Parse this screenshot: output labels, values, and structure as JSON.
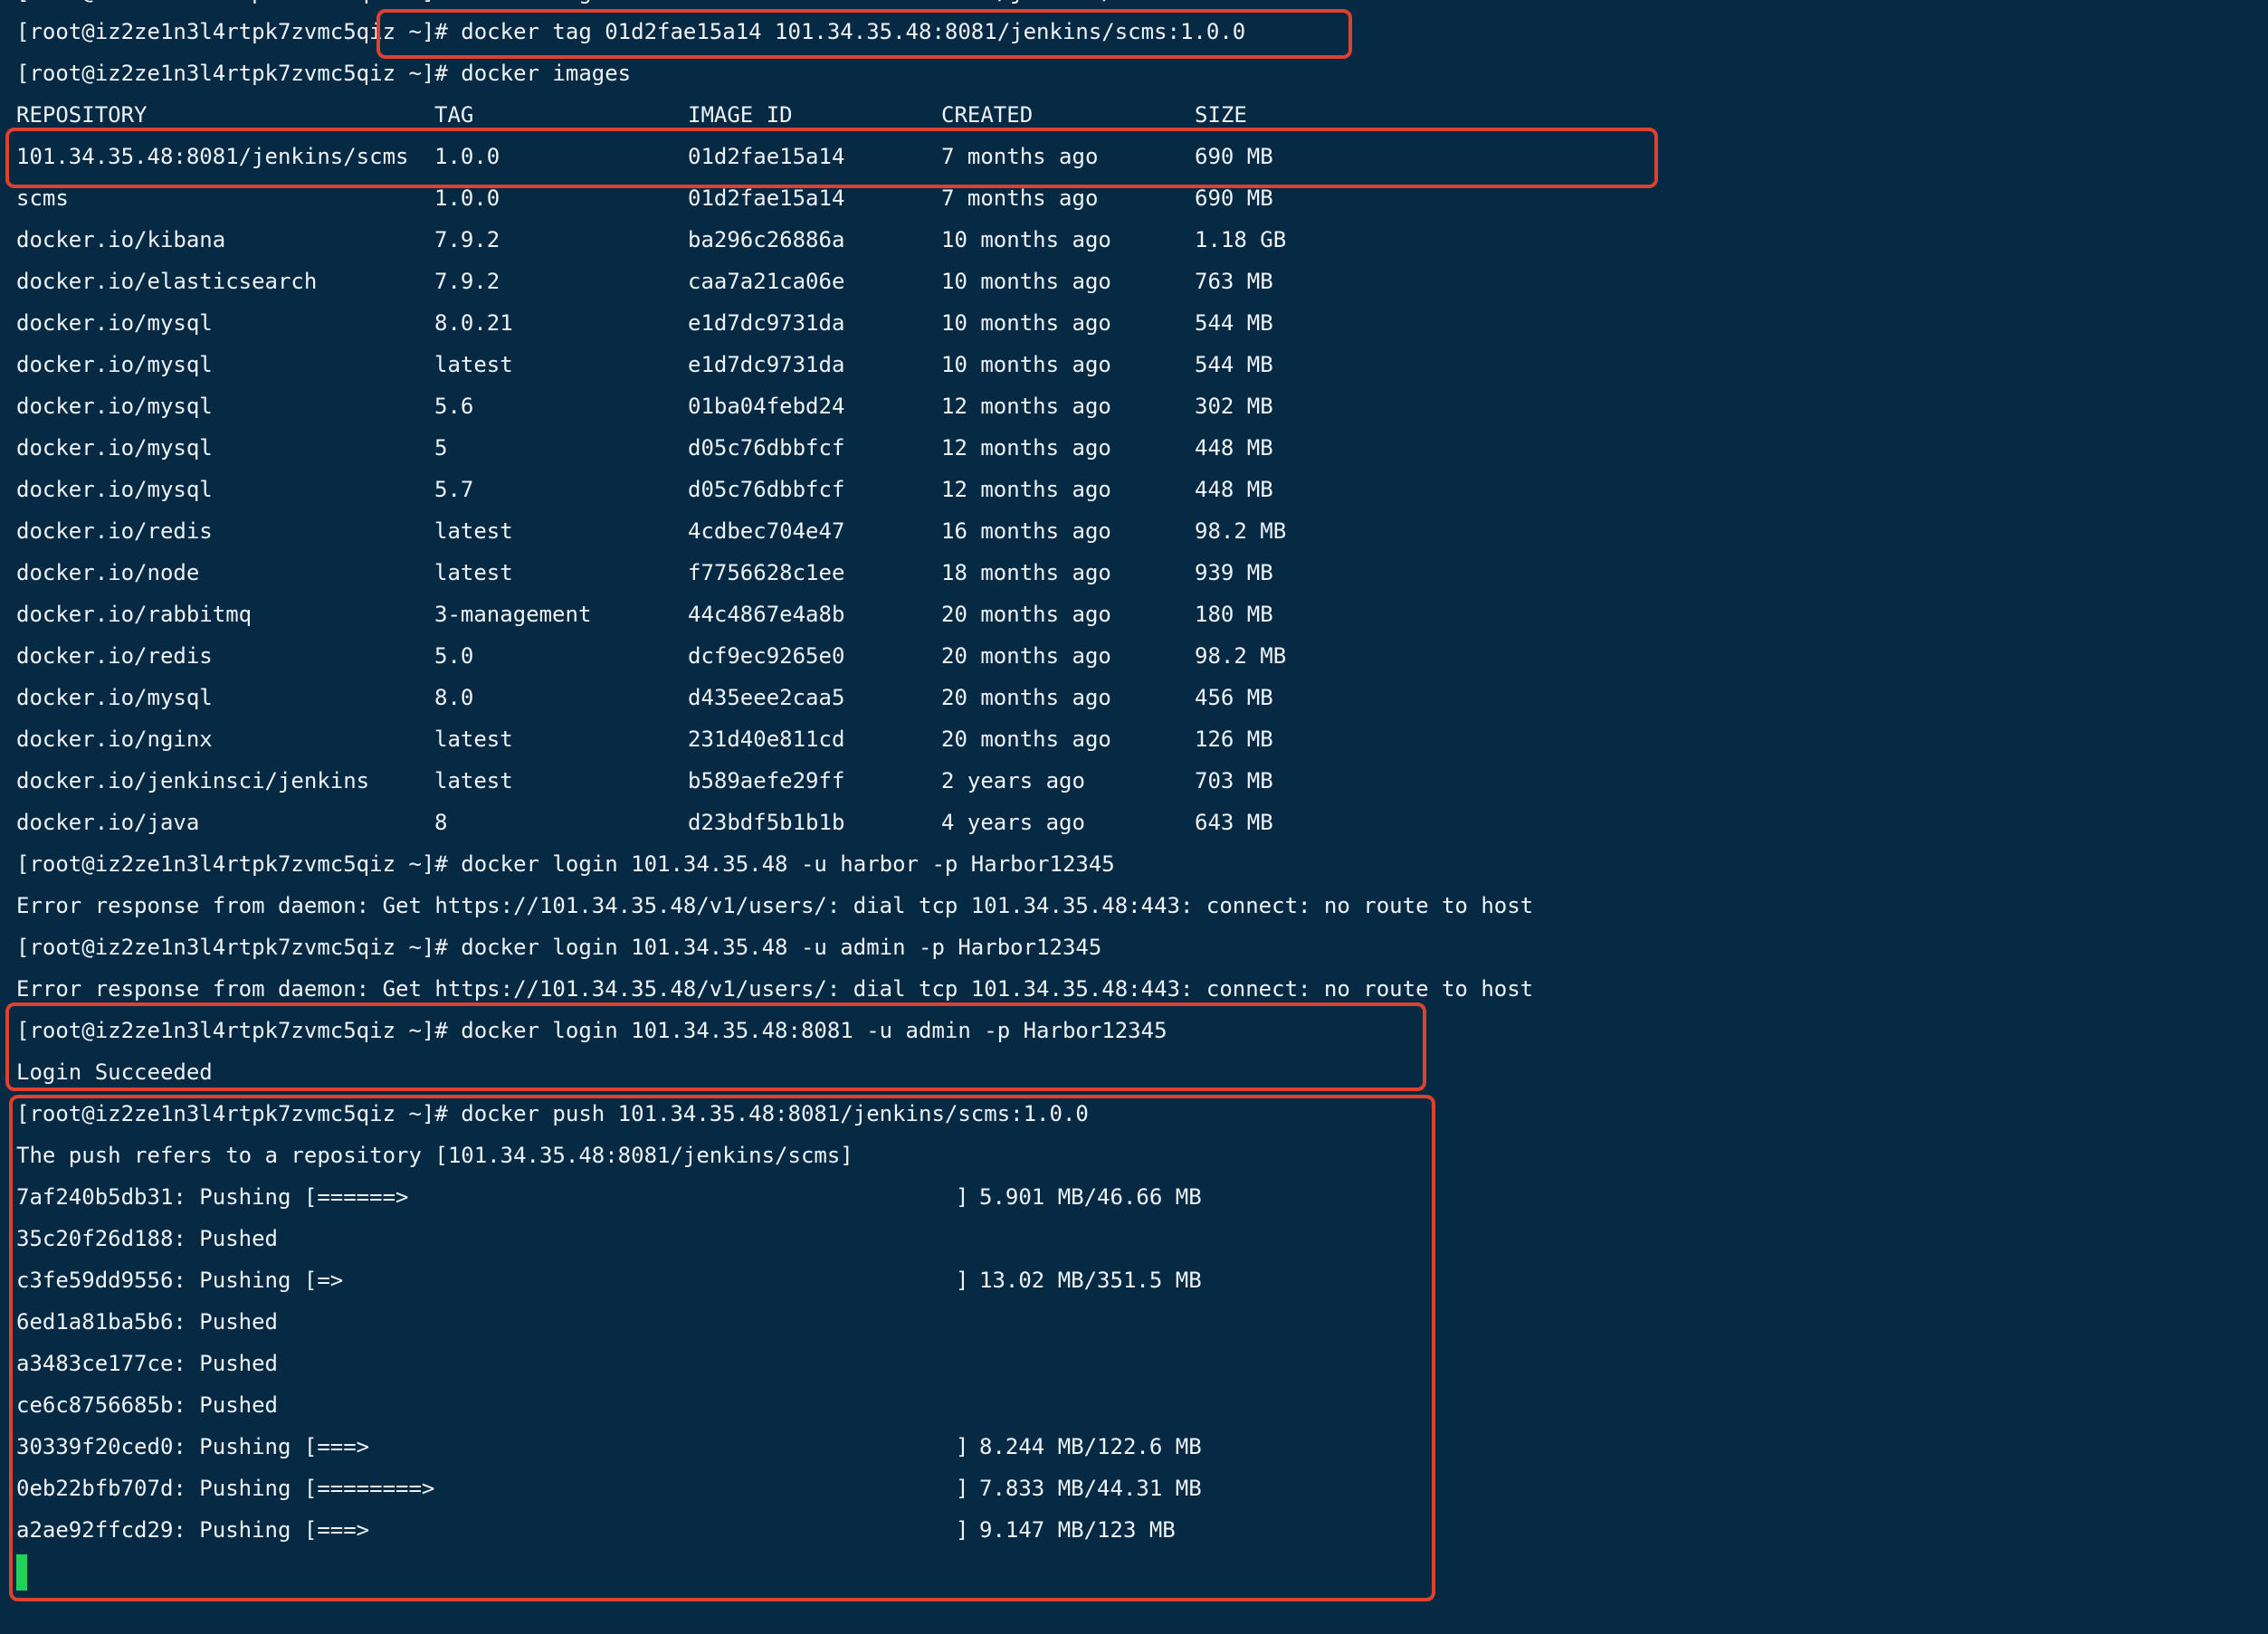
{
  "terminal": {
    "partial_line": "[root@iz2ze1n3l4rtpk7zvmc5qiz ~]# docker tag 01d2fae15a14 101.34.35.48:8081/jenkins/scms:1.0.0",
    "cmd_tag": "[root@iz2ze1n3l4rtpk7zvmc5qiz ~]# docker tag 01d2fae15a14 101.34.35.48:8081/jenkins/scms:1.0.0",
    "cmd_images": "[root@iz2ze1n3l4rtpk7zvmc5qiz ~]# docker images",
    "table": {
      "headers": [
        "REPOSITORY",
        "TAG",
        "IMAGE ID",
        "CREATED",
        "SIZE"
      ],
      "rows": [
        [
          "101.34.35.48:8081/jenkins/scms",
          "1.0.0",
          "01d2fae15a14",
          "7 months ago",
          "690 MB"
        ],
        [
          "scms",
          "1.0.0",
          "01d2fae15a14",
          "7 months ago",
          "690 MB"
        ],
        [
          "docker.io/kibana",
          "7.9.2",
          "ba296c26886a",
          "10 months ago",
          "1.18 GB"
        ],
        [
          "docker.io/elasticsearch",
          "7.9.2",
          "caa7a21ca06e",
          "10 months ago",
          "763 MB"
        ],
        [
          "docker.io/mysql",
          "8.0.21",
          "e1d7dc9731da",
          "10 months ago",
          "544 MB"
        ],
        [
          "docker.io/mysql",
          "latest",
          "e1d7dc9731da",
          "10 months ago",
          "544 MB"
        ],
        [
          "docker.io/mysql",
          "5.6",
          "01ba04febd24",
          "12 months ago",
          "302 MB"
        ],
        [
          "docker.io/mysql",
          "5",
          "d05c76dbbfcf",
          "12 months ago",
          "448 MB"
        ],
        [
          "docker.io/mysql",
          "5.7",
          "d05c76dbbfcf",
          "12 months ago",
          "448 MB"
        ],
        [
          "docker.io/redis",
          "latest",
          "4cdbec704e47",
          "16 months ago",
          "98.2 MB"
        ],
        [
          "docker.io/node",
          "latest",
          "f7756628c1ee",
          "18 months ago",
          "939 MB"
        ],
        [
          "docker.io/rabbitmq",
          "3-management",
          "44c4867e4a8b",
          "20 months ago",
          "180 MB"
        ],
        [
          "docker.io/redis",
          "5.0",
          "dcf9ec9265e0",
          "20 months ago",
          "98.2 MB"
        ],
        [
          "docker.io/mysql",
          "8.0",
          "d435eee2caa5",
          "20 months ago",
          "456 MB"
        ],
        [
          "docker.io/nginx",
          "latest",
          "231d40e811cd",
          "20 months ago",
          "126 MB"
        ],
        [
          "docker.io/jenkinsci/jenkins",
          "latest",
          "b589aefe29ff",
          "2 years ago",
          "703 MB"
        ],
        [
          "docker.io/java",
          "8",
          "d23bdf5b1b1b",
          "4 years ago",
          "643 MB"
        ]
      ]
    },
    "cmd_login_harbor": "[root@iz2ze1n3l4rtpk7zvmc5qiz ~]# docker login 101.34.35.48 -u harbor -p Harbor12345",
    "err_1": "Error response from daemon: Get https://101.34.35.48/v1/users/: dial tcp 101.34.35.48:443: connect: no route to host",
    "cmd_login_admin": "[root@iz2ze1n3l4rtpk7zvmc5qiz ~]# docker login 101.34.35.48 -u admin -p Harbor12345",
    "err_2": "Error response from daemon: Get https://101.34.35.48/v1/users/: dial tcp 101.34.35.48:443: connect: no route to host",
    "cmd_login_8081": "[root@iz2ze1n3l4rtpk7zvmc5qiz ~]# docker login 101.34.35.48:8081 -u admin -p Harbor12345",
    "login_succeeded": "Login Succeeded",
    "cmd_push": "[root@iz2ze1n3l4rtpk7zvmc5qiz ~]# docker push 101.34.35.48:8081/jenkins/scms:1.0.0",
    "push_refers": "The push refers to a repository [101.34.35.48:8081/jenkins/scms]",
    "push_layers": [
      {
        "layer": "7af240b5db31: Pushing [======>",
        "bracket": "]",
        "progress": "5.901 MB/46.66 MB"
      },
      {
        "layer": "35c20f26d188: Pushed",
        "bracket": "",
        "progress": ""
      },
      {
        "layer": "c3fe59dd9556: Pushing [=>",
        "bracket": "]",
        "progress": "13.02 MB/351.5 MB"
      },
      {
        "layer": "6ed1a81ba5b6: Pushed",
        "bracket": "",
        "progress": ""
      },
      {
        "layer": "a3483ce177ce: Pushed",
        "bracket": "",
        "progress": ""
      },
      {
        "layer": "ce6c8756685b: Pushed",
        "bracket": "",
        "progress": ""
      },
      {
        "layer": "30339f20ced0: Pushing [===>",
        "bracket": "]",
        "progress": "8.244 MB/122.6 MB"
      },
      {
        "layer": "0eb22bfb707d: Pushing [========>",
        "bracket": "]",
        "progress": "7.833 MB/44.31 MB"
      },
      {
        "layer": "a2ae92ffcd29: Pushing [===>",
        "bracket": "]",
        "progress": "9.147 MB/123 MB"
      }
    ]
  },
  "colors": {
    "background": "#062a43",
    "text": "#eef3f7",
    "highlight": "#e0412f",
    "cursor": "#21d35b"
  }
}
